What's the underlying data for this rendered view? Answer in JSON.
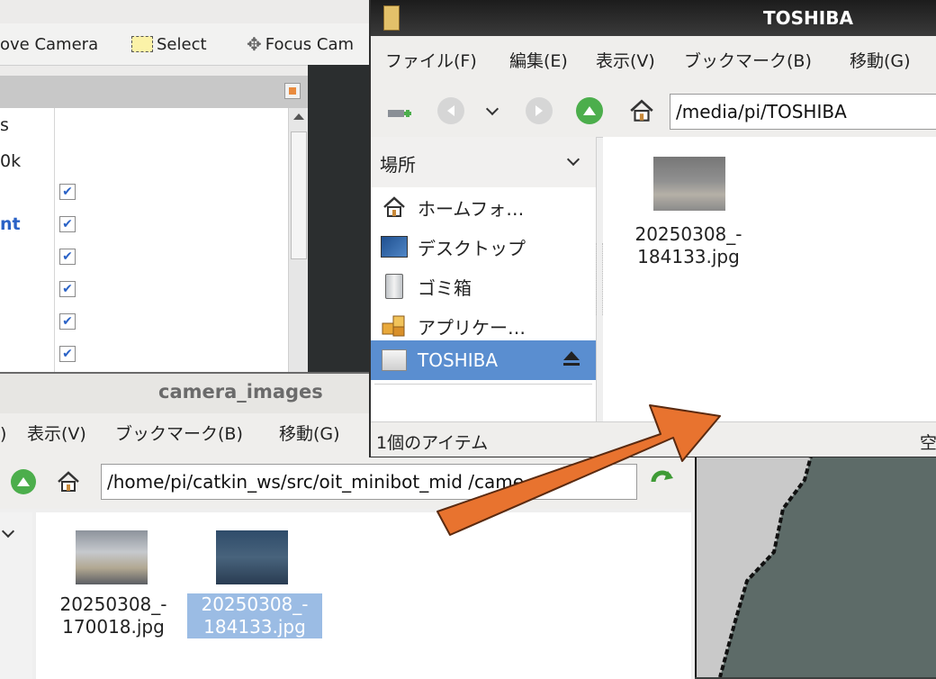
{
  "rviz": {
    "toolbar": {
      "move_camera": "ove Camera",
      "select": "Select",
      "focus_camera": "Focus Cam"
    },
    "displays_text": [
      "s",
      "0k",
      "nt"
    ],
    "checked_rows": 6
  },
  "camera_window": {
    "title": "camera_images",
    "menu": [
      ")",
      "表示(V)",
      "ブックマーク(B)",
      "移動(G)"
    ],
    "path": "/home/pi/catkin_ws/src/oit_minibot_mid        /came",
    "files": [
      {
        "name_line1": "20250308_-",
        "name_line2": "170018.jpg",
        "selected": false
      },
      {
        "name_line1": "20250308_-",
        "name_line2": "184133.jpg",
        "selected": true
      }
    ]
  },
  "toshiba_window": {
    "title": "TOSHIBA",
    "menu": [
      "ファイル(F)",
      "編集(E)",
      "表示(V)",
      "ブックマーク(B)",
      "移動(G)"
    ],
    "path": "/media/pi/TOSHIBA",
    "sidebar_header": "場所",
    "sidebar_items": [
      {
        "label": "ホームフォ…",
        "icon": "home-icon"
      },
      {
        "label": "デスクトップ",
        "icon": "desktop-icon"
      },
      {
        "label": "ゴミ箱",
        "icon": "trash-icon"
      },
      {
        "label": "アプリケー…",
        "icon": "applications-icon"
      },
      {
        "label": "TOSHIBA",
        "icon": "drive-icon",
        "selected": true
      }
    ],
    "file": {
      "name_line1": "20250308_-",
      "name_line2": "184133.jpg"
    },
    "status": "1個のアイテム",
    "status_right": "空"
  },
  "colors": {
    "arrow": "#e8732f",
    "selection": "#5a8ed0",
    "title_dark": "#1c1c1c"
  }
}
